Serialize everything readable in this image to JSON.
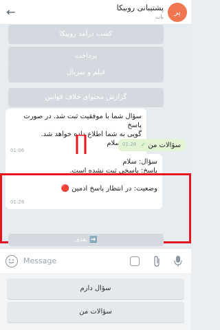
{
  "header": {
    "title": "پشتیبانی روبیکا",
    "subtitle": "بات",
    "avatar_text": "پر",
    "back_icon": "arrow-left-icon"
  },
  "chat": {
    "inline_buttons": [
      "کسب درآمد روبیکا",
      "پرداخت",
      "فیلم و سریال",
      "گزارش محتوای خلاف قوانین"
    ],
    "incoming_1": {
      "lines": [
        "سؤال شما با موفقیت ثبت شد. در صورت پاسخ",
        "گویی به شما اطلاع داده خواهد شد.",
        "سؤال: سلام"
      ],
      "time": "01:06"
    },
    "outgoing_1": {
      "text": "سؤالات من",
      "time": "01:28",
      "status": "✓"
    },
    "incoming_2": {
      "lines": [
        "سؤال: سلام",
        "پاسخ: پاسخی ثبت نشده است.",
        "",
        "وضعیت: در انتظار پاسخ ادمین 🔴"
      ],
      "time": "01:28"
    },
    "next_button": "➡️ بعدی"
  },
  "input": {
    "placeholder": "Message",
    "emoji_icon": "smile-icon",
    "sticker_icon": "sticker-icon",
    "attach_icon": "paperclip-icon",
    "mic_icon": "microphone-icon"
  },
  "reply_keyboard": {
    "buttons": [
      "سؤال دارم",
      "سؤالات من"
    ]
  },
  "colors": {
    "highlight_border": "#e8141e",
    "arrow": "#e8141e",
    "avatar": "#ef7651",
    "outgoing_bubble": "#e2f4d4"
  }
}
